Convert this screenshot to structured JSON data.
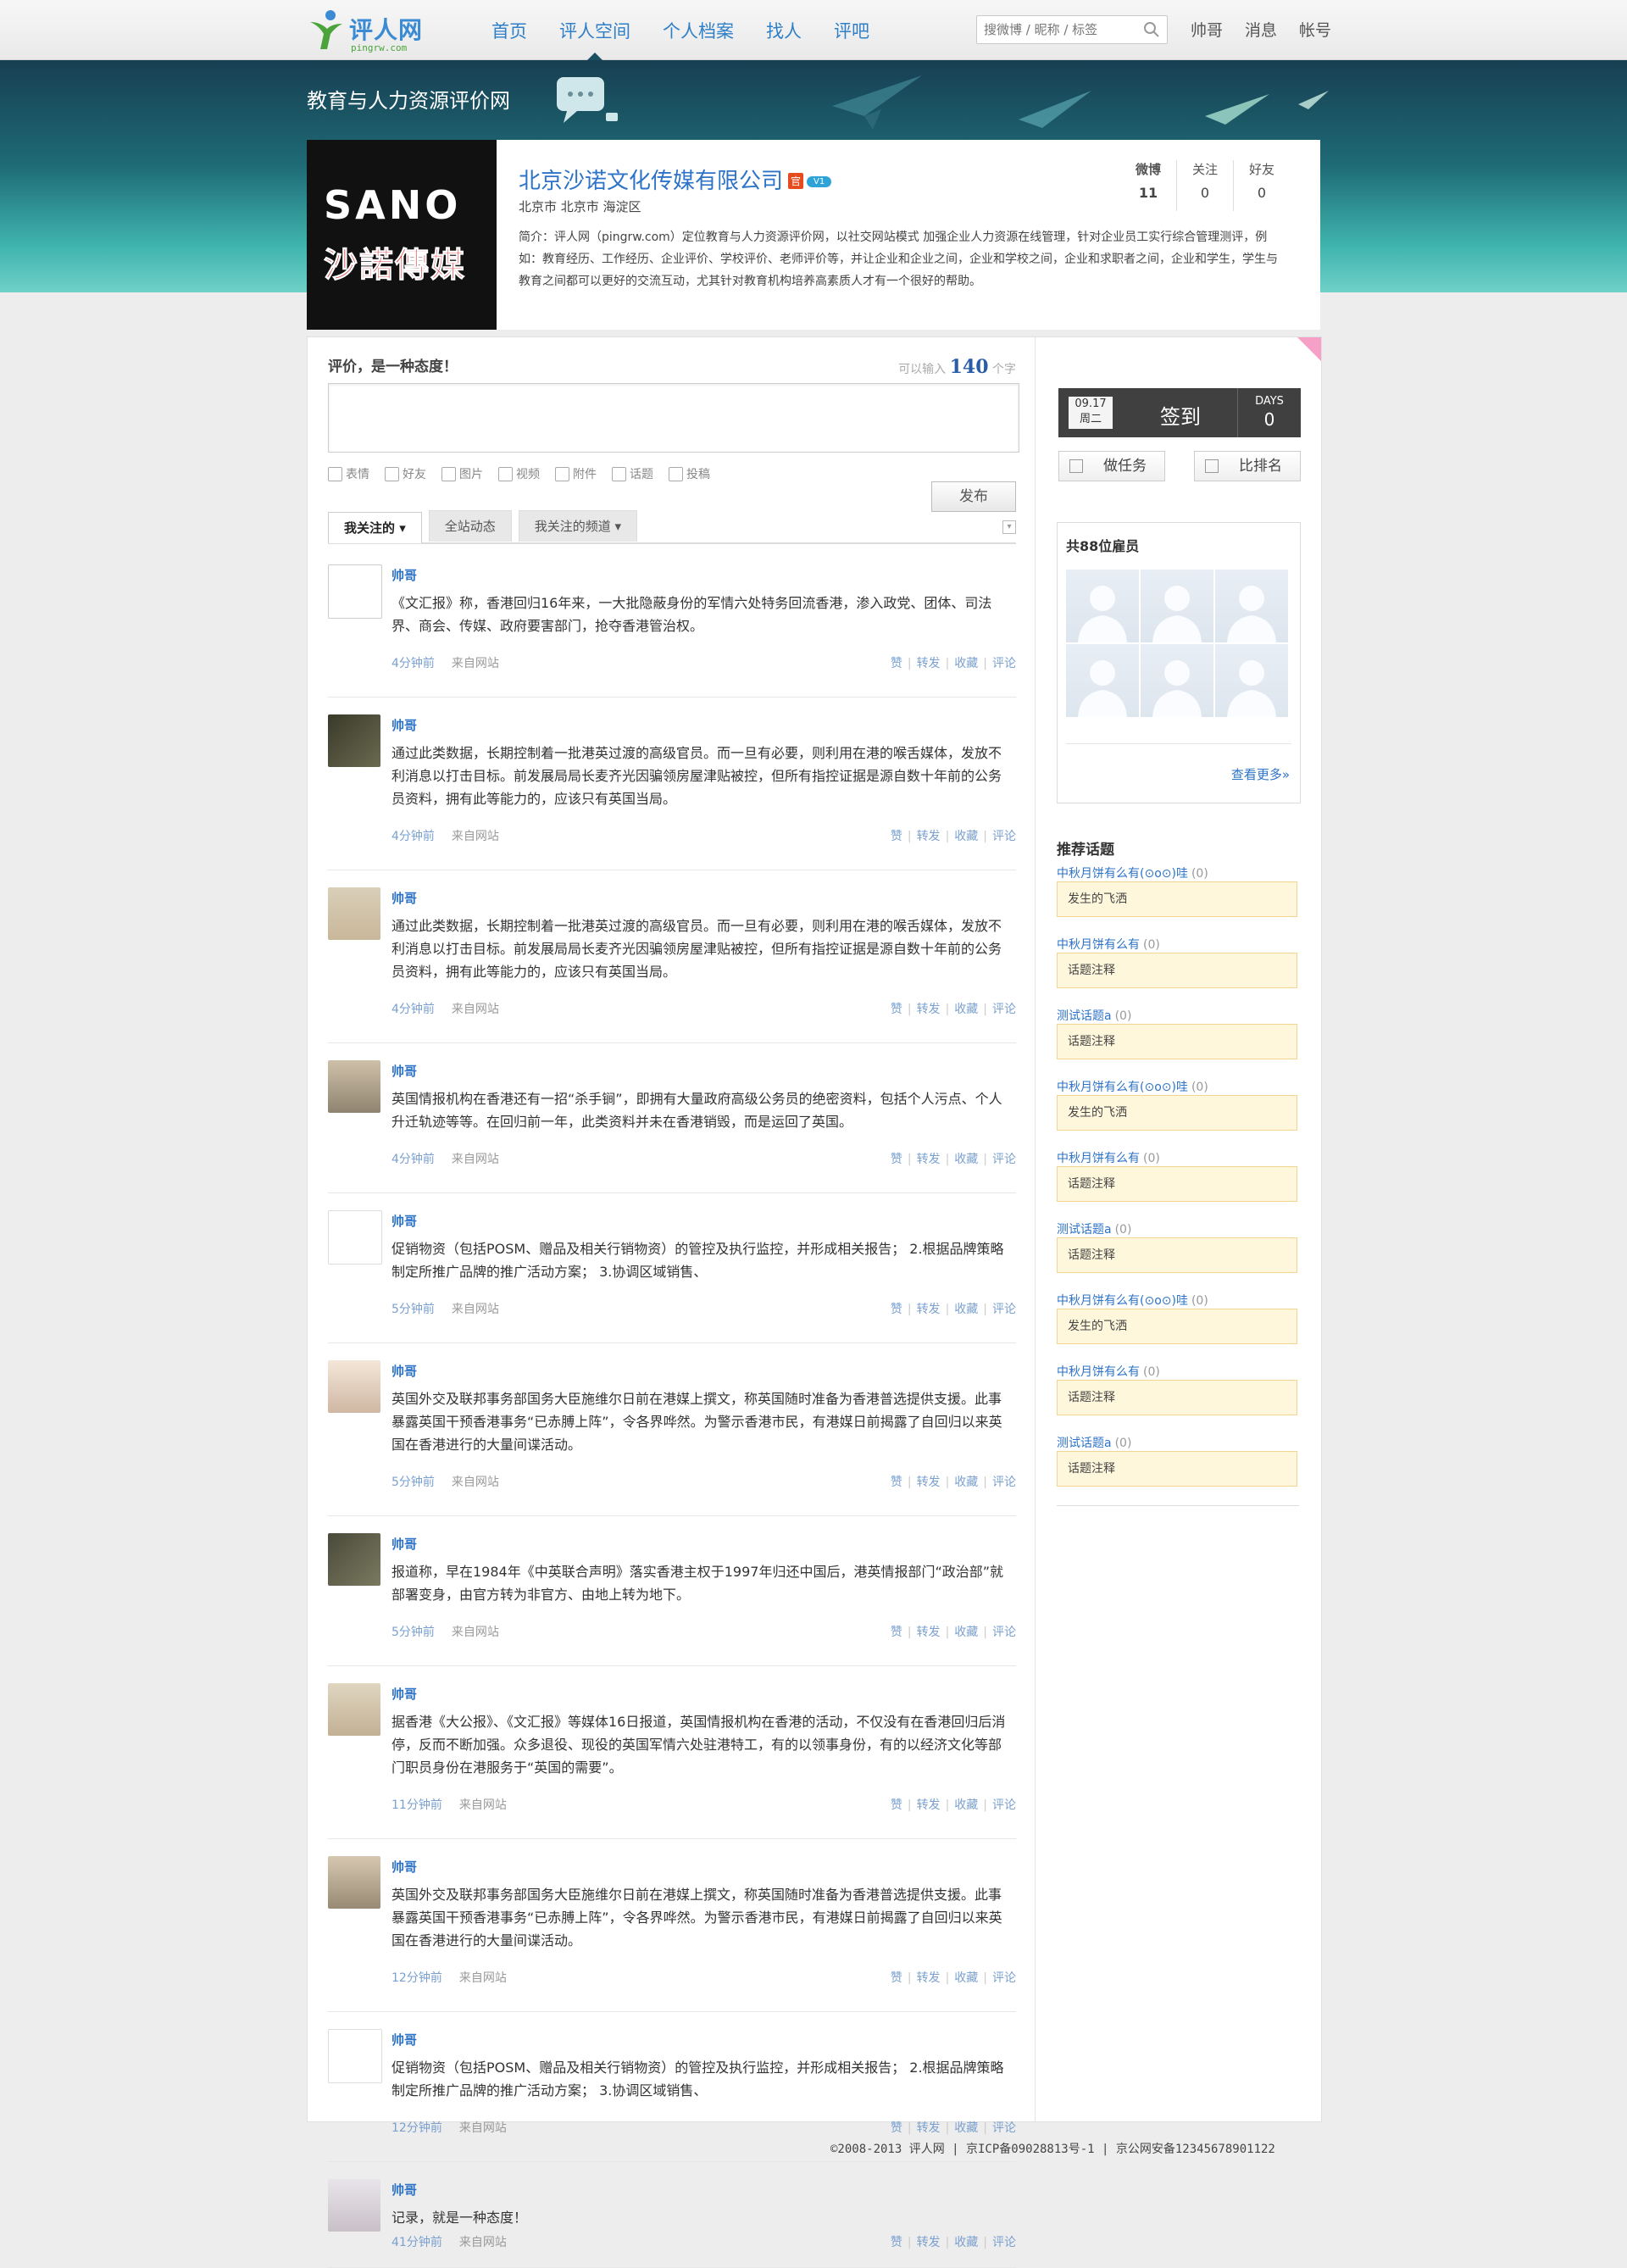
{
  "logo": {
    "name": "评人网",
    "sub": "pingrw.com"
  },
  "nav": [
    "首页",
    "评人空间",
    "个人档案",
    "找人",
    "评吧"
  ],
  "search": {
    "placeholder": "搜微博 / 昵称 / 标签"
  },
  "user_menu": [
    "帅哥",
    "消息",
    "帐号"
  ],
  "banner": {
    "title": "教育与人力资源评价网"
  },
  "profile": {
    "avatar_text_en": "SANO",
    "avatar_text_cn": "沙諾傳媒",
    "company": "北京沙诺文化传媒有限公司",
    "badge_official": "官",
    "badge_v": "V1",
    "location": "北京市 北京市 海淀区",
    "intro": "简介：评人网（pingrw.com）定位教育与人力资源评价网，以社交网站模式 加强企业人力资源在线管理，针对企业员工实行综合管理测评，例如：教育经历、工作经历、企业评价、学校评价、老师评价等，并让企业和企业之间，企业和学校之间，企业和求职者之间，企业和学生，学生与教育之间都可以更好的交流互动，尤其针对教育机构培养高素质人才有一个很好的帮助。",
    "stats": [
      {
        "label": "微博",
        "value": "11"
      },
      {
        "label": "关注",
        "value": "0"
      },
      {
        "label": "好友",
        "value": "0"
      }
    ]
  },
  "compose": {
    "title": "评价，是一种态度！",
    "counter_prefix": "可以输入",
    "counter_num": "140",
    "counter_suffix": "个字",
    "tools": [
      "表情",
      "好友",
      "图片",
      "视频",
      "附件",
      "话题",
      "投稿"
    ],
    "publish": "发布"
  },
  "tabs": [
    "我关注的 ▾",
    "全站动态",
    "我关注的频道 ▾"
  ],
  "actions": [
    "赞",
    "转发",
    "收藏",
    "评论"
  ],
  "posts": [
    {
      "author": "帅哥",
      "text": "《文汇报》称，香港回归16年来，一大批隐蔽身份的军情六处特务回流香港，渗入政党、团体、司法界、商会、传媒、政府要害部门，抢夺香港管治权。",
      "time": "4分钟前",
      "source": "来自网站"
    },
    {
      "author": "帅哥",
      "text": "通过此类数据，长期控制着一批港英过渡的高级官员。而一旦有必要，则利用在港的喉舌媒体，发放不利消息以打击目标。前发展局局长麦齐光因骗领房屋津贴被控，但所有指控证据是源自数十年前的公务员资料，拥有此等能力的，应该只有英国当局。",
      "time": "4分钟前",
      "source": "来自网站"
    },
    {
      "author": "帅哥",
      "text": "通过此类数据，长期控制着一批港英过渡的高级官员。而一旦有必要，则利用在港的喉舌媒体，发放不利消息以打击目标。前发展局局长麦齐光因骗领房屋津贴被控，但所有指控证据是源自数十年前的公务员资料，拥有此等能力的，应该只有英国当局。",
      "time": "4分钟前",
      "source": "来自网站"
    },
    {
      "author": "帅哥",
      "text": "英国情报机构在香港还有一招“杀手锏”，即拥有大量政府高级公务员的绝密资料，包括个人污点、个人升迁轨迹等等。在回归前一年，此类资料并未在香港销毁，而是运回了英国。",
      "time": "4分钟前",
      "source": "来自网站"
    },
    {
      "author": "帅哥",
      "text": "促销物资（包括POSM、赠品及相关行销物资）的管控及执行监控，并形成相关报告； 2.根据品牌策略制定所推广品牌的推广活动方案； 3.协调区域销售、",
      "time": "5分钟前",
      "source": "来自网站"
    },
    {
      "author": "帅哥",
      "text": "英国外交及联邦事务部国务大臣施维尔日前在港媒上撰文，称英国随时准备为香港普选提供支援。此事暴露英国干预香港事务“已赤膊上阵”，令各界哗然。为警示香港市民，有港媒日前揭露了自回归以来英国在香港进行的大量间谍活动。",
      "time": "5分钟前",
      "source": "来自网站"
    },
    {
      "author": "帅哥",
      "text": "报道称，早在1984年《中英联合声明》落实香港主权于1997年归还中国后，港英情报部门“政治部”就部署变身，由官方转为非官方、由地上转为地下。",
      "time": "5分钟前",
      "source": "来自网站"
    },
    {
      "author": "帅哥",
      "text": "据香港《大公报》、《文汇报》等媒体16日报道，英国情报机构在香港的活动，不仅没有在香港回归后消停，反而不断加强。众多退役、现役的英国军情六处驻港特工，有的以领事身份，有的以经济文化等部门职员身份在港服务于“英国的需要”。",
      "time": "11分钟前",
      "source": "来自网站"
    },
    {
      "author": "帅哥",
      "text": "英国外交及联邦事务部国务大臣施维尔日前在港媒上撰文，称英国随时准备为香港普选提供支援。此事暴露英国干预香港事务“已赤膊上阵”，令各界哗然。为警示香港市民，有港媒日前揭露了自回归以来英国在香港进行的大量间谍活动。",
      "time": "12分钟前",
      "source": "来自网站"
    },
    {
      "author": "帅哥",
      "text": "促销物资（包括POSM、赠品及相关行销物资）的管控及执行监控，并形成相关报告； 2.根据品牌策略制定所推广品牌的推广活动方案； 3.协调区域销售、",
      "time": "12分钟前",
      "source": "来自网站"
    },
    {
      "author": "帅哥",
      "text": "记录，就是一种态度！",
      "time": "41分钟前",
      "source": "来自网站"
    }
  ],
  "checkin": {
    "date": "09.17",
    "weekday": "周二",
    "label": "签到",
    "days_label": "DAYS",
    "days": "0"
  },
  "right_buttons": [
    "做任务",
    "比排名"
  ],
  "employees": {
    "title": "共88位雇员",
    "more": "查看更多»"
  },
  "topics_title": "推荐话题",
  "topics": [
    {
      "name": "中秋月饼有么有(⊙o⊙)哇",
      "count": "(0)",
      "note": "发生的飞洒"
    },
    {
      "name": "中秋月饼有么有",
      "count": "(0)",
      "note": "话题注释"
    },
    {
      "name": "测试话题a",
      "count": "(0)",
      "note": "话题注释"
    },
    {
      "name": "中秋月饼有么有(⊙o⊙)哇",
      "count": "(0)",
      "note": "发生的飞洒"
    },
    {
      "name": "中秋月饼有么有",
      "count": "(0)",
      "note": "话题注释"
    },
    {
      "name": "测试话题a",
      "count": "(0)",
      "note": "话题注释"
    },
    {
      "name": "中秋月饼有么有(⊙o⊙)哇",
      "count": "(0)",
      "note": "发生的飞洒"
    },
    {
      "name": "中秋月饼有么有",
      "count": "(0)",
      "note": "话题注释"
    },
    {
      "name": "测试话题a",
      "count": "(0)",
      "note": "话题注释"
    }
  ],
  "footer": "©2008-2013 评人网 | 京ICP备09028813号-1 | 京公网安备12345678901122"
}
